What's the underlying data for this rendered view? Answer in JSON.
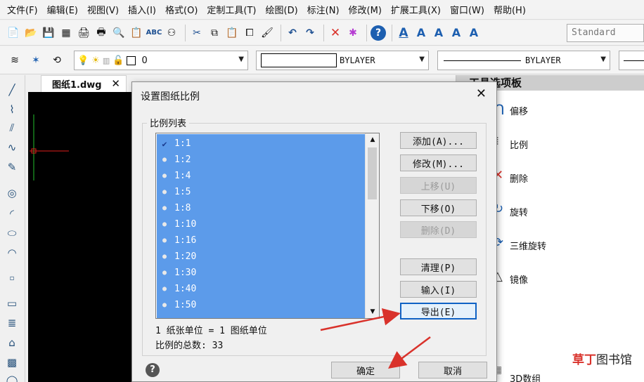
{
  "menubar": {
    "items": [
      "文件(F)",
      "编辑(E)",
      "视图(V)",
      "插入(I)",
      "格式(O)",
      "定制工具(T)",
      "绘图(D)",
      "标注(N)",
      "修改(M)",
      "扩展工具(X)",
      "窗口(W)",
      "帮助(H)"
    ]
  },
  "toolbar1": {
    "style_value": "Standard"
  },
  "toolbar2": {
    "layer_value": "0",
    "color_value": "BYLAYER",
    "linetype_value": "BYLAYER"
  },
  "document": {
    "tab_label": "图纸1.dwg",
    "close_glyph": "✕"
  },
  "palette": {
    "title": "工具选项板",
    "items": [
      "偏移",
      "比例",
      "删除",
      "旋转",
      "三维旋转",
      "镜像",
      "3D数组"
    ]
  },
  "watermark": {
    "text": "图书馆",
    "mark": "草丁"
  },
  "dialog": {
    "title": "设置图纸比例",
    "close_glyph": "✕",
    "group_label": "比例列表",
    "scales": [
      {
        "label": "1:1",
        "checked": true
      },
      {
        "label": "1:2",
        "checked": false
      },
      {
        "label": "1:4",
        "checked": false
      },
      {
        "label": "1:5",
        "checked": false
      },
      {
        "label": "1:8",
        "checked": false
      },
      {
        "label": "1:10",
        "checked": false
      },
      {
        "label": "1:16",
        "checked": false
      },
      {
        "label": "1:20",
        "checked": false
      },
      {
        "label": "1:30",
        "checked": false
      },
      {
        "label": "1:40",
        "checked": false
      },
      {
        "label": "1:50",
        "checked": false
      }
    ],
    "buttons": {
      "add": "添加(A)...",
      "modify": "修改(M)...",
      "move_up": "上移(U)",
      "move_down": "下移(O)",
      "delete": "删除(D)",
      "purge": "清理(P)",
      "import": "输入(I)",
      "export": "导出(E)"
    },
    "info_units": "1 纸张单位 = 1 图纸单位",
    "info_total": "比例的总数: 33",
    "ok": "确定",
    "cancel": "取消",
    "help_glyph": "?"
  },
  "colors": {
    "list_bg": "#5c9bea",
    "arrow_red": "#d9322b",
    "focus_blue": "#0f62c4"
  }
}
